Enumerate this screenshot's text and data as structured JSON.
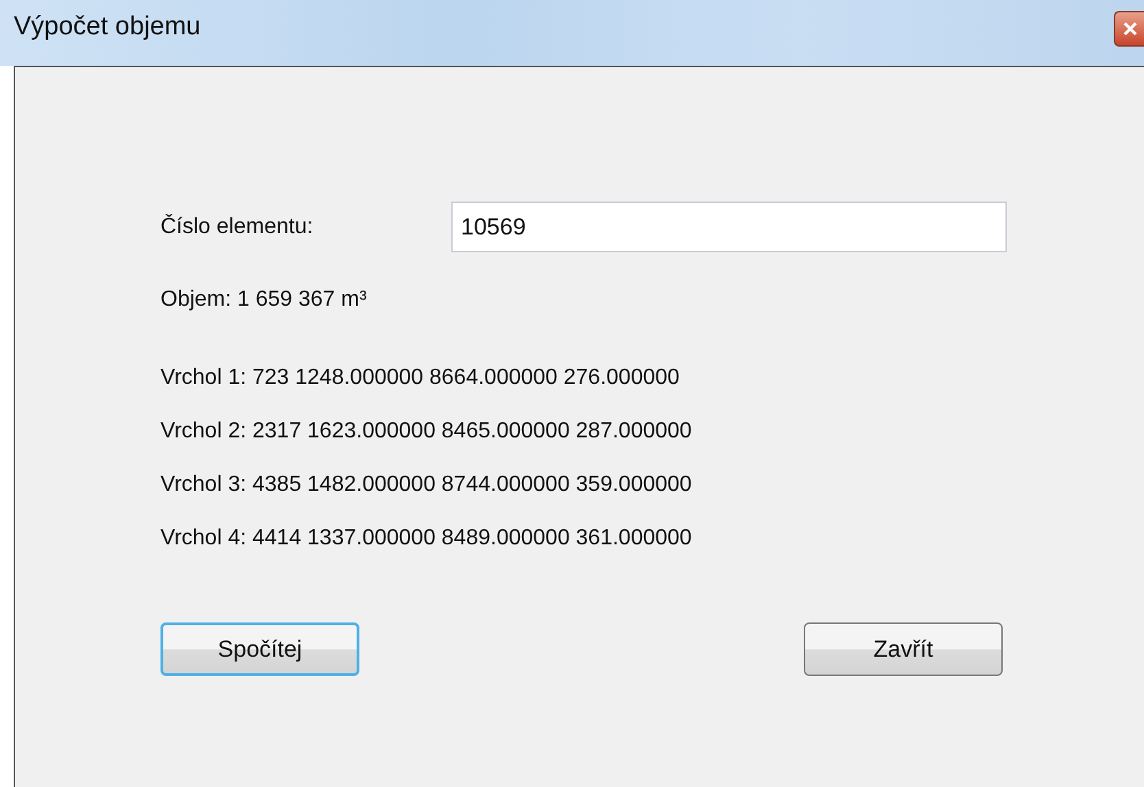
{
  "window": {
    "title": "Výpočet objemu"
  },
  "element_field": {
    "label": "Číslo elementu:",
    "value": "10569"
  },
  "volume": "Objem: 1 659 367  m³",
  "vertices": [
    "Vrchol 1: 723 1248.000000 8664.000000 276.000000",
    "Vrchol 2: 2317 1623.000000 8465.000000 287.000000",
    "Vrchol 3: 4385 1482.000000 8744.000000 359.000000",
    "Vrchol 4: 4414 1337.000000 8489.000000 361.000000"
  ],
  "buttons": [
    {
      "label": "Spočítej",
      "focused": true
    },
    {
      "label": "Zavřít",
      "focused": false
    }
  ]
}
